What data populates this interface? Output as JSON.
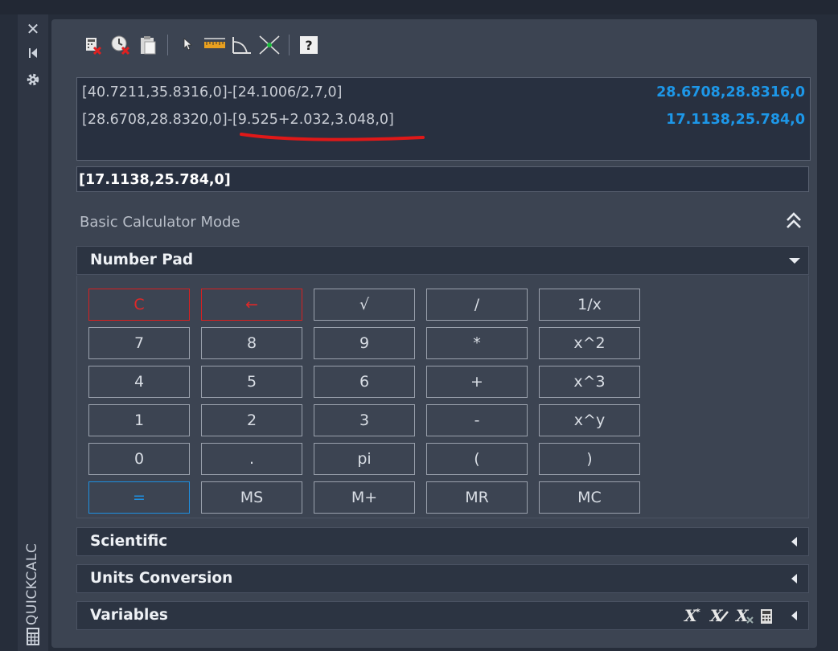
{
  "sidebar": {
    "title": "QUICKCALC",
    "close_icon": "close-icon",
    "pin_icon": "pin-icon",
    "settings_icon": "gear-icon",
    "calc_icon": "calculator-icon"
  },
  "toolbar": {
    "buttons": [
      "clear-icon",
      "clear-history-icon",
      "paste-icon",
      "get-coordinates-icon",
      "distance-icon",
      "angle-icon",
      "intersection-icon",
      "help-icon"
    ]
  },
  "history": {
    "rows": [
      {
        "expr": "[40.7211,35.8316,0]-[24.1006/2,7,0]",
        "result": "28.6708,28.8316,0"
      },
      {
        "expr_prefix": "[28.6708,28.8320,0]-",
        "expr_highlight": "[9.525+2.032,3.048,0]",
        "result": "17.1138,25.784,0"
      }
    ],
    "annotation_color": "#e01818"
  },
  "input": {
    "value": "[17.1138,25.784,0]"
  },
  "mode": {
    "label": "Basic Calculator Mode"
  },
  "sections": {
    "number_pad": "Number Pad",
    "scientific": "Scientific",
    "units_conversion": "Units Conversion",
    "variables": "Variables"
  },
  "keys": [
    [
      "C",
      "←",
      "√",
      "/",
      "1/x"
    ],
    [
      "7",
      "8",
      "9",
      "*",
      "x^2"
    ],
    [
      "4",
      "5",
      "6",
      "+",
      "x^3"
    ],
    [
      "1",
      "2",
      "3",
      "-",
      "x^y"
    ],
    [
      "0",
      ".",
      "pi",
      "(",
      ")"
    ],
    [
      "=",
      "MS",
      "M+",
      "MR",
      "MC"
    ]
  ],
  "colors": {
    "result_blue": "#1d97e8",
    "clear_red": "#e02828",
    "equals_blue": "#1e8fe0"
  }
}
